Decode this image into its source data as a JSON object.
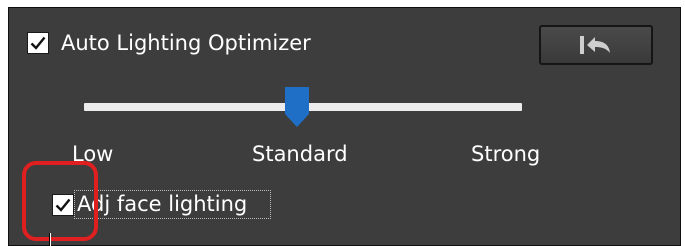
{
  "auto_lighting": {
    "label": "Auto Lighting Optimizer",
    "checked": true
  },
  "reset_button": {
    "icon": "reset-to-default-icon"
  },
  "slider": {
    "levels": [
      "Low",
      "Standard",
      "Strong"
    ],
    "selected": "Standard",
    "value_fraction": 0.5
  },
  "face_lighting": {
    "label": "Adj face lighting",
    "checked": true
  },
  "colors": {
    "panel_bg": "#3d3d3d",
    "text": "#ffffff",
    "track": "#ececec",
    "thumb": "#1f6fc7",
    "highlight": "#e02020"
  }
}
